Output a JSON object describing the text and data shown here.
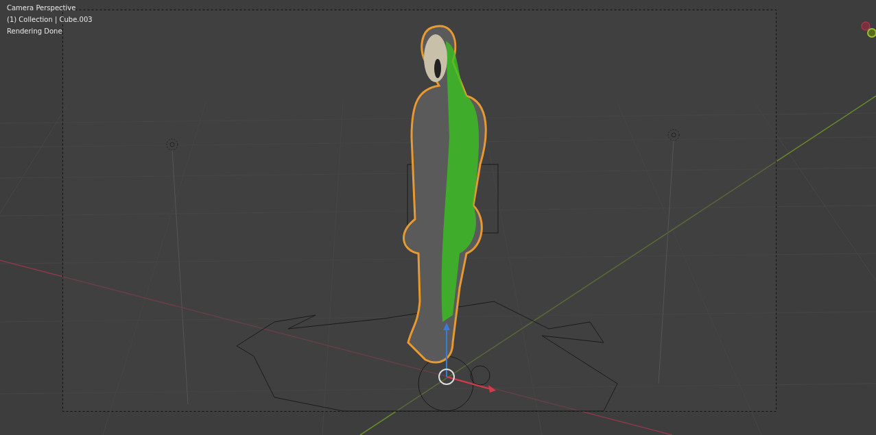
{
  "viewport": {
    "overlay_lines": [
      "Camera Perspective",
      "(1) Collection | Cube.003",
      "Rendering Done"
    ]
  }
}
